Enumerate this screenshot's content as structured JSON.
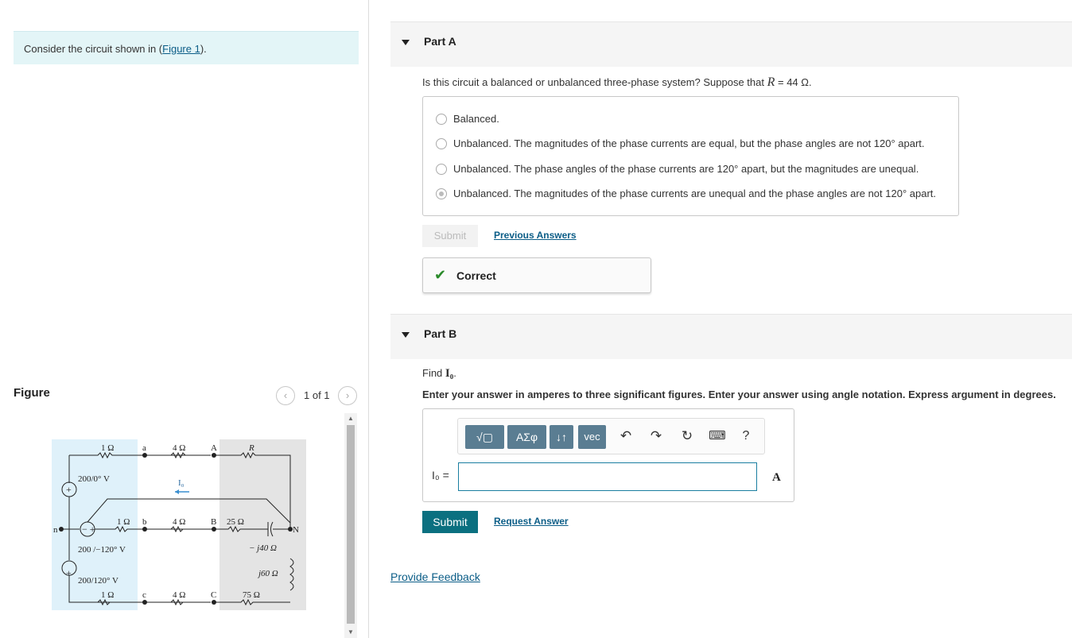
{
  "intro": {
    "text_prefix": "Consider the circuit shown in (",
    "link": "Figure 1",
    "text_suffix": ")."
  },
  "figure": {
    "title": "Figure",
    "pager": "1 of 1",
    "prev_icon": "chevron-left-icon",
    "next_icon": "chevron-right-icon",
    "circuit": {
      "r1a": "1 Ω",
      "node_a": "a",
      "r4a": "4 Ω",
      "node_A": "A",
      "R": "R",
      "va": "200/0° V",
      "io": "I₀",
      "r1b": "1 Ω",
      "node_b": "b",
      "r4b": "4 Ω",
      "node_B": "B",
      "r25": "25 Ω",
      "node_n": "n",
      "node_N": "N",
      "vb": "200 /−120° V",
      "cap": "− j40 Ω",
      "ind": "j60 Ω",
      "vc": "200/120° V",
      "r1c": "1 Ω",
      "node_c": "c",
      "r4c": "4 Ω",
      "node_C": "C",
      "r75": "75 Ω"
    }
  },
  "partA": {
    "label": "Part A",
    "question_prefix": "Is this circuit a balanced or unbalanced three-phase system? Suppose that ",
    "question_var": "R",
    "question_suffix": " = 44 Ω.",
    "options": [
      "Balanced.",
      "Unbalanced. The magnitudes of the phase currents are equal, but the phase angles are not 120° apart.",
      "Unbalanced. The phase angles of the phase currents are 120° apart, but the magnitudes are unequal.",
      "Unbalanced. The magnitudes of the phase currents are unequal and the phase angles are not 120° apart."
    ],
    "selected_index": 3,
    "submit": "Submit",
    "previous_answers": "Previous Answers",
    "result": "Correct"
  },
  "partB": {
    "label": "Part B",
    "find_prefix": "Find ",
    "find_var": "I₀",
    "find_suffix": ".",
    "instructions": "Enter your answer in amperes to three significant figures. Enter your answer using angle notation. Express argument in degrees.",
    "toolbar": {
      "templates": "√▢",
      "greek": "ΑΣφ",
      "arrows": "↓↑",
      "vec": "vec",
      "undo_icon": "undo-icon",
      "redo_icon": "redo-icon",
      "reset_icon": "reset-icon",
      "keyboard_icon": "keyboard-icon",
      "help": "?"
    },
    "input_label": "I₀ =",
    "input_value": "",
    "unit": "A",
    "submit": "Submit",
    "request_answer": "Request Answer"
  },
  "feedback_link": "Provide Feedback",
  "colors": {
    "accent": "#0b7080",
    "link": "#0b5d87",
    "intro_bg": "#e3f5f7",
    "toolbar_btn": "#5a7d92",
    "correct_check": "#2a8a2a"
  }
}
